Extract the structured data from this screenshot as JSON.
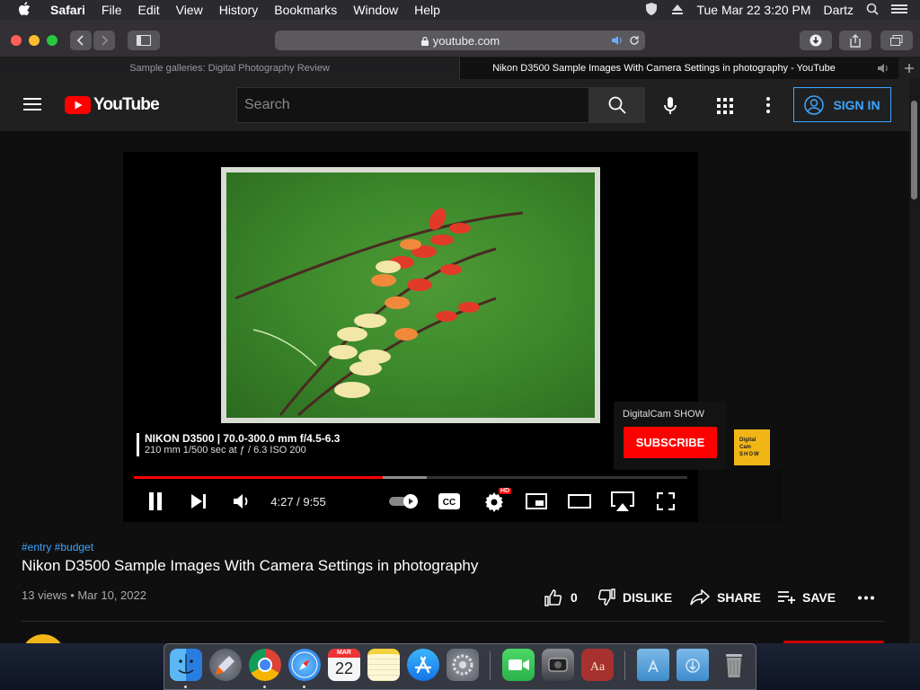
{
  "menubar": {
    "app": "Safari",
    "items": [
      "File",
      "Edit",
      "View",
      "History",
      "Bookmarks",
      "Window",
      "Help"
    ],
    "date_time": "Tue Mar 22  3:20 PM",
    "user": "Dartz"
  },
  "safari": {
    "url": "youtube.com",
    "tabs": [
      {
        "title": "Sample galleries: Digital Photography Review",
        "active": false
      },
      {
        "title": "Nikon D3500 Sample Images With Camera Settings in photography - YouTube",
        "active": true
      }
    ]
  },
  "youtube": {
    "logo_text": "YouTube",
    "search_placeholder": "Search",
    "sign_in": "SIGN IN"
  },
  "player": {
    "exif_line1": "NIKON D3500 | 70.0-300.0 mm f/4.5-6.3",
    "exif_line2": "210 mm 1/500 sec at ƒ / 6.3 ISO 200",
    "channel_card_name": "DigitalCam SHOW",
    "subscribe_label": "SUBSCRIBE",
    "thumb_text": [
      "Digital",
      "Cam",
      "SHOW"
    ],
    "time": "4:27 / 9:55",
    "played_fraction": 0.45,
    "buffered_fraction": 0.53,
    "hd_badge": "HD"
  },
  "video": {
    "hashtags": "#entry #budget",
    "title": "Nikon D3500 Sample Images With Camera Settings in photography",
    "views_date": "13 views • Mar 10, 2022",
    "likes": "0",
    "dislike_label": "DISLIKE",
    "share_label": "SHARE",
    "save_label": "SAVE"
  },
  "dock": {
    "calendar_month": "MAR",
    "calendar_day": "22",
    "icons": [
      "finder-icon",
      "launchpad-icon",
      "chrome-icon",
      "safari-icon",
      "calendar-icon",
      "notes-icon",
      "app-store-icon",
      "system-preferences-icon",
      "facetime-icon",
      "screenshot-icon",
      "dictionary-icon",
      "applications-folder-icon",
      "downloads-folder-icon",
      "trash-icon"
    ]
  },
  "colors": {
    "yt_red": "#ff0000",
    "link_blue": "#3ea6ff",
    "sign_in_blue": "#3ea6ff"
  }
}
